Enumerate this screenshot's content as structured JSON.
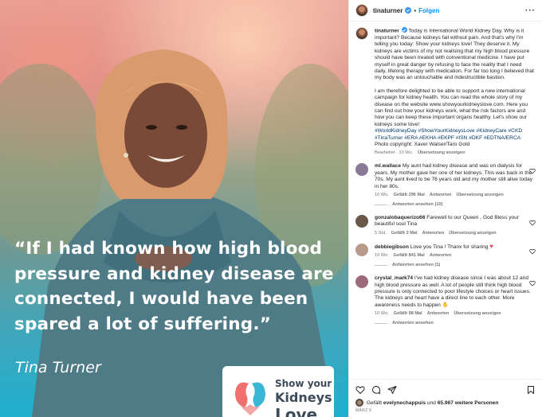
{
  "post": {
    "quote": "“If I had known how high blood pressure and kidney disease are connected, I would have been spared a lot of suffering.”",
    "author": "Tina Turner",
    "logo": {
      "line1": "Show your",
      "line2": "Kidneys",
      "line3": "Love"
    }
  },
  "header": {
    "username": "tinaturner",
    "separator": "•",
    "follow_label": "Folgen",
    "more": "···"
  },
  "caption": {
    "username": "tinaturner",
    "paragraph1": "Today is International World Kidney Day. Why is it important? Because kidneys fail without pain. And that's why I'm telling you today: Show your kidneys love! They deserve it. My kidneys are victims of my not realising that my high blood pressure should have been treated with conventional medicine. I have put myself in great danger by refusing to face the reality that I need daily, lifelong therapy with medication. For far too long I believed that my body was an untouchable and indestructible bastion.",
    "paragraph2": "I am therefore delighted to be able to support a new international campaign for kidney health. You can read the whole story of my disease on the website www.showyourkidneyslove.com. Here you can find out how your kidneys work, what the risk factors are and how you can keep these important organs healthy. Let's show our kidneys some love!",
    "hashtags": "#WorldKidneyDay #ShowYourKidneysLove #KidneyCare #CKD #TinaTurner #ERA #EKHA #EKPF #ISN #DKF #EDTNA/ERCA",
    "credit": "Photo copyright: Xaver Walser/Taro Gold",
    "meta": {
      "edited": "Bearbeitet",
      "dot": "·",
      "time": "10 Wo.",
      "translate": "Übersetzung anzeigen"
    }
  },
  "comments": [
    {
      "username": "ml.wallace",
      "text": "My aunt had kidney disease and was on dialysis for years. My mother gave her one of her kidneys. This was back in the 70s. My aunt lived to be 76 years old and my mother still alive today in her 80s.",
      "time": "10 Wo.",
      "likes": "Gefällt 296 Mal",
      "reply": "Antworten",
      "translate": "Übersetzung anzeigen",
      "replies": "Antworten ansehen (10)",
      "avatar_color": "#8a7a9a"
    },
    {
      "username": "gonzalobaquerizo66",
      "text": "Farewell to our Queen , God Bless your beautiful soul Tina",
      "time": "5 Std.",
      "likes": "Gefällt 2 Mal",
      "reply": "Antworten",
      "translate": "Übersetzung anzeigen",
      "replies": "",
      "avatar_color": "#6a5848"
    },
    {
      "username": "debbiegibson",
      "text": "Love you Tina ! Thanx for sharing",
      "time": "10 Wo.",
      "likes": "Gefällt 841 Mal",
      "reply": "Antworten",
      "translate": "",
      "replies": "Antworten ansehen (1)",
      "avatar_color": "#b89a8a"
    },
    {
      "username": "crystal_mark74",
      "text": "I've had kidney disease since I was about 12 and high blood pressure as well. A lot of people still think high blood pressure is only connected to poor lifestyle choices or heart issues. The kidneys and heart have a direct line to each other. More awareness needs to happen",
      "time": "10 Wo.",
      "likes": "Gefällt 98 Mal",
      "reply": "Antworten",
      "translate": "Übersetzung anzeigen",
      "replies": "Antworten ansehen",
      "avatar_color": "#9a6a7a"
    }
  ],
  "footer": {
    "liked_prefix": "Gefällt",
    "liked_user": "evelynechappuis",
    "liked_suffix": "und",
    "liked_count": "65.967 weitere Personen",
    "date": "MÄRZ 9"
  },
  "colors": {
    "link": "#0095f6",
    "hashtag": "#00376b",
    "verified": "#3897f0",
    "heart": "#ed4956"
  }
}
